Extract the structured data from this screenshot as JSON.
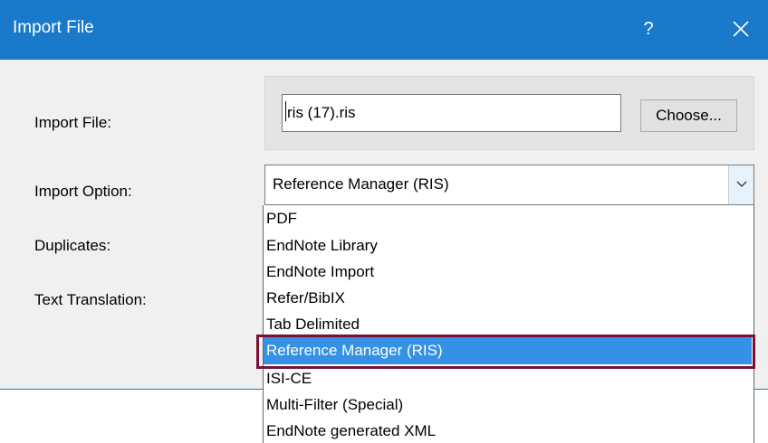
{
  "window": {
    "title": "Import File",
    "help_glyph": "?"
  },
  "form": {
    "import_file_label": "Import File:",
    "import_file_value": "ris (17).ris",
    "choose_label": "Choose...",
    "import_option_label": "Import Option:",
    "import_option_value": "Reference Manager (RIS)",
    "duplicates_label": "Duplicates:",
    "text_translation_label": "Text Translation:"
  },
  "dropdown": {
    "items": [
      "PDF",
      "EndNote Library",
      "EndNote Import",
      "Refer/BibIX",
      "Tab Delimited",
      "Reference Manager (RIS)",
      "ISI-CE",
      "Multi-Filter (Special)",
      "EndNote generated XML"
    ],
    "selected": "Reference Manager (RIS)"
  },
  "colors": {
    "titlebar": "#1979ca",
    "selection": "#3591e6",
    "highlight_outline": "#7a1034"
  },
  "icons": {
    "close": "close-icon",
    "dropdown": "chevron-down-icon"
  }
}
